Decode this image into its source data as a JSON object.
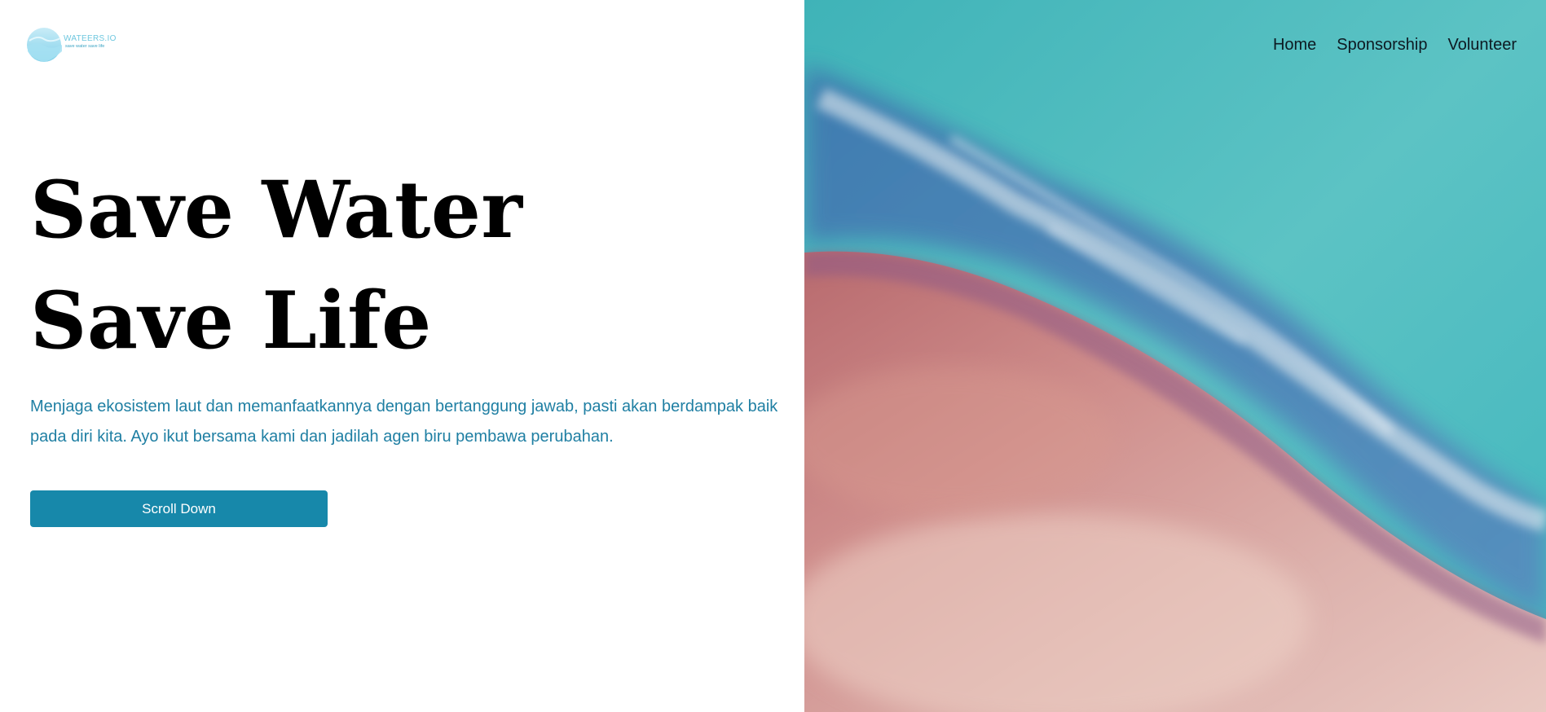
{
  "brand": {
    "name": "WATEERS.IO",
    "tagline": "save water save life",
    "color": "#6ec7df"
  },
  "nav": {
    "items": [
      {
        "label": "Home"
      },
      {
        "label": "Sponsorship"
      },
      {
        "label": "Volunteer"
      }
    ]
  },
  "hero": {
    "title_line1": "Save Water",
    "title_line2": "Save Life",
    "description": "Menjaga ekosistem laut dan memanfaatkannya dengan bertanggung jawab, pasti akan berdampak baik pada diri kita. Ayo ikut bersama kami dan jadilah agen biru pembawa perubahan.",
    "button_label": "Scroll Down"
  },
  "colors": {
    "accent": "#1788aa",
    "description_text": "#1f7fa3",
    "title_text": "#000000"
  }
}
